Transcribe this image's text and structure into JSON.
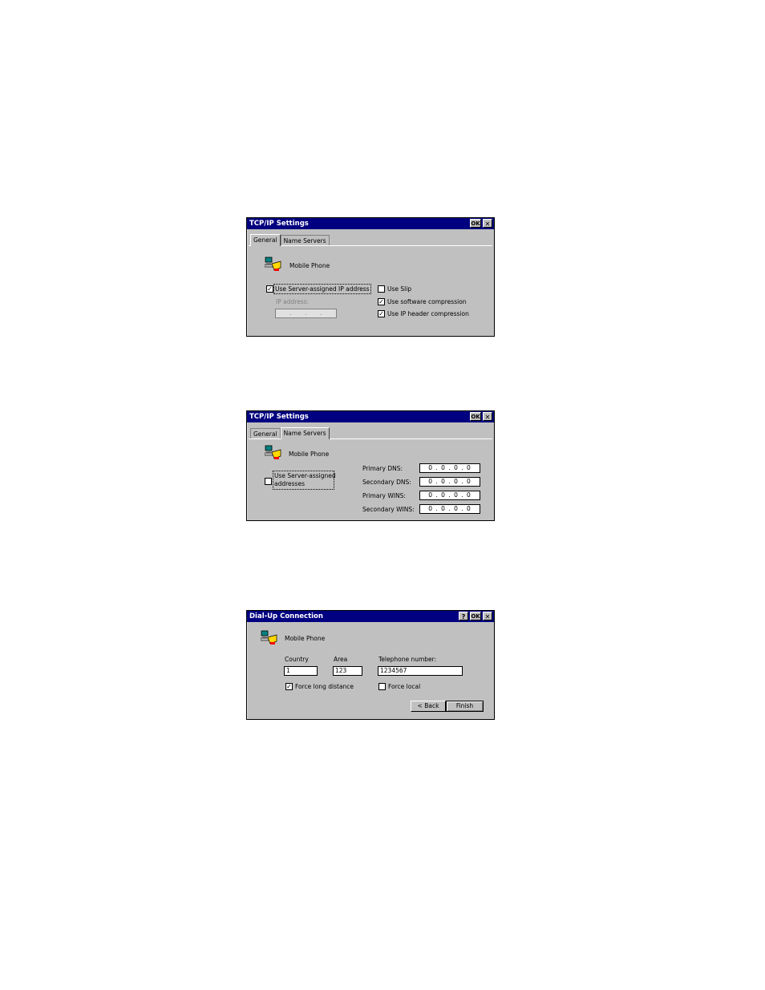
{
  "dialogs": [
    {
      "title": "TCP/IP Settings",
      "buttons": {
        "ok": "OK",
        "close": "✕"
      },
      "tabs": [
        "General",
        "Name Servers"
      ],
      "active_tab": "General",
      "connection_name": "Mobile Phone",
      "use_server_ip": {
        "label": "Use Server-assigned IP address",
        "checked": "✓"
      },
      "ip_address_label": "IP address:",
      "use_slip": {
        "label": "Use Slip",
        "checked": ""
      },
      "use_sw_compression": {
        "label": "Use software compression",
        "checked": "✓"
      },
      "use_ip_header_compression": {
        "label": "Use IP header compression",
        "checked": "✓"
      }
    },
    {
      "title": "TCP/IP Settings",
      "buttons": {
        "ok": "OK",
        "close": "✕"
      },
      "tabs": [
        "General",
        "Name Servers"
      ],
      "active_tab": "Name Servers",
      "connection_name": "Mobile Phone",
      "use_server_addresses": {
        "label_line1": "Use Server-assigned",
        "label_line2": "addresses",
        "checked": ""
      },
      "primary_dns": {
        "label": "Primary DNS:",
        "value": "0 . 0 . 0 . 0"
      },
      "secondary_dns": {
        "label": "Secondary DNS:",
        "value": "0 . 0 . 0 . 0"
      },
      "primary_wins": {
        "label": "Primary WINS:",
        "value": "0 . 0 . 0 . 0"
      },
      "secondary_wins": {
        "label": "Secondary WINS:",
        "value": "0 . 0 . 0 . 0"
      }
    },
    {
      "title": "Dial-Up Connection",
      "buttons": {
        "help": "?",
        "ok": "OK",
        "close": "✕"
      },
      "connection_name": "Mobile Phone",
      "country": {
        "label": "Country",
        "value": "1"
      },
      "area": {
        "label": "Area",
        "value": "123"
      },
      "telephone": {
        "label": "Telephone number:",
        "value": "1234567"
      },
      "force_long_distance": {
        "label": "Force long distance",
        "checked": "✓"
      },
      "force_local": {
        "label": "Force local",
        "checked": ""
      },
      "back_button": "< Back",
      "finish_button": "Finish"
    }
  ],
  "icons": {
    "connection": "dialup-connection-icon",
    "close": "close-icon",
    "check": "checkmark-icon"
  }
}
